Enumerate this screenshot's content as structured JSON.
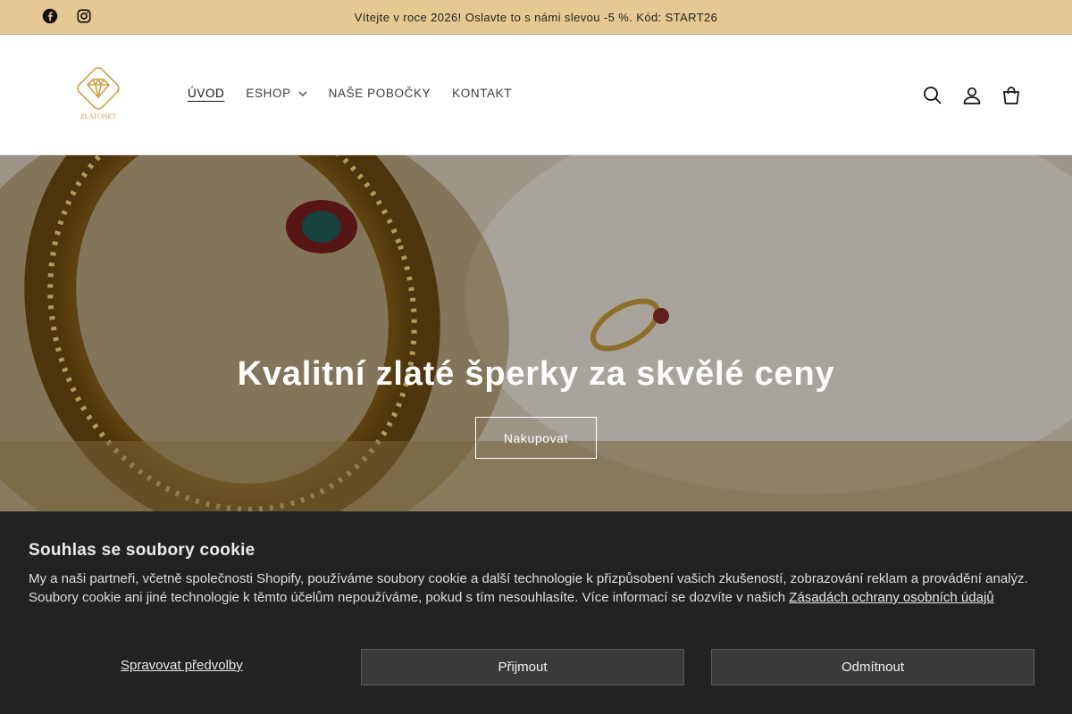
{
  "announcement": {
    "text": "Vítejte v roce 2026! Oslavte to s námi slevou -5 %. Kód: START26"
  },
  "social": [
    {
      "icon": "facebook-icon"
    },
    {
      "icon": "instagram-icon"
    }
  ],
  "logo": {
    "text": "ZLATONET"
  },
  "nav": {
    "items": [
      {
        "label": "ÚVOD"
      },
      {
        "label": "ESHOP"
      },
      {
        "label": "NAŠE POBOČKY"
      },
      {
        "label": "KONTAKT"
      }
    ]
  },
  "header_icons": [
    "search-icon",
    "account-icon",
    "cart-icon"
  ],
  "hero": {
    "title": "Kvalitní zlaté šperky za skvělé ceny",
    "button": "Nakupovat"
  },
  "cookie": {
    "title": "Souhlas se soubory cookie",
    "body": "My a naši partneři, včetně společnosti Shopify, používáme soubory cookie a další technologie k přizpůsobení vašich zkušeností, zobrazování reklam a provádění analýz. Soubory cookie ani jiné technologie k těmto účelům nepoužíváme, pokud s tím nesouhlasíte. Více informací se dozvíte v našich ",
    "link": "Zásadách ochrany osobních údajů",
    "manage": "Spravovat předvolby",
    "accept": "Přijmout",
    "decline": "Odmítnout"
  },
  "colors": {
    "announcement_bg": "#e6c992",
    "cookie_bg": "#222222",
    "logo_gold": "#c9a24a"
  }
}
